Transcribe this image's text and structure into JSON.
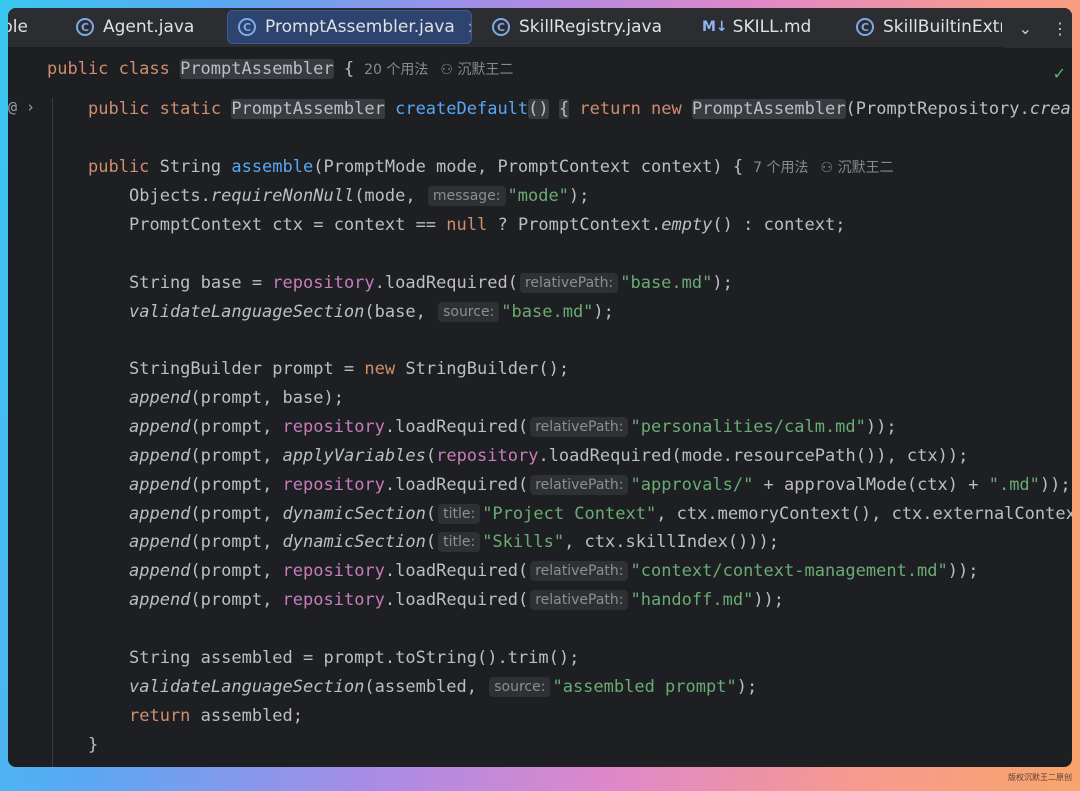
{
  "tabs": [
    {
      "label": "ple",
      "icon": ""
    },
    {
      "label": "Agent.java",
      "icon": "java-class-icon"
    },
    {
      "label": "PromptAssembler.java",
      "icon": "java-class-icon",
      "active": true,
      "close": "×"
    },
    {
      "label": "SkillRegistry.java",
      "icon": "java-class-icon"
    },
    {
      "label": "SKILL.md",
      "icon": "markdown-icon",
      "icon_text": "M↓"
    },
    {
      "label": "SkillBuiltinExtra",
      "icon": "java-class-icon"
    }
  ],
  "tab_tools": {
    "dropdown": "⌄",
    "more": "⋮"
  },
  "class_header": {
    "decl_kw": "public class",
    "name": "PromptAssembler",
    "brace": "{",
    "usages": "20 个用法",
    "author": "沉默王二"
  },
  "gutter_mark": "@ ›",
  "code": {
    "l_create": {
      "kw1": "public static",
      "type": "PromptAssembler",
      "name": "createDefault",
      "paren": "()",
      "brace": "{",
      "ret": "return new",
      "type2": "PromptAssembler",
      "tail": "(PromptRepository.",
      "tail_it": "creat"
    },
    "l_assemble": {
      "kw": "public",
      "sig1": "String",
      "name": "assemble",
      "params": "(PromptMode mode, PromptContext context) {",
      "usages": "7 个用法",
      "author": "沉默王二"
    },
    "l_objects": {
      "a": "Objects.",
      "b": "requireNonNull",
      "c": "(mode,",
      "hint": "message:",
      "str": "\"mode\"",
      "end": ");"
    },
    "l_ctx": {
      "a": "PromptContext ctx = context == ",
      "null": "null",
      "b": " ? PromptContext.",
      "empty": "empty",
      "c": "() : context;"
    },
    "l_base": {
      "a": "String base = ",
      "repo": "repository",
      "b": ".loadRequired(",
      "hint": "relativePath:",
      "str": "\"base.md\"",
      "end": ");"
    },
    "l_validate1": {
      "fn": "validateLanguageSection",
      "a": "(base,",
      "hint": "source:",
      "str": "\"base.md\"",
      "end": ");"
    },
    "l_sb": {
      "a": "StringBuilder prompt = ",
      "kw": "new",
      "b": " StringBuilder();"
    },
    "l_app1": {
      "fn": "append",
      "a": "(prompt, base);"
    },
    "l_app2": {
      "fn": "append",
      "a": "(prompt, ",
      "repo": "repository",
      "b": ".loadRequired(",
      "hint": "relativePath:",
      "str": "\"personalities/calm.md\"",
      "end": "));"
    },
    "l_app3": {
      "fn": "append",
      "a": "(prompt, ",
      "fn2": "applyVariables",
      "b": "(",
      "repo": "repository",
      "c": ".loadRequired(mode.resourcePath()), ctx));"
    },
    "l_app4": {
      "fn": "append",
      "a": "(prompt, ",
      "repo": "repository",
      "b": ".loadRequired(",
      "hint": "relativePath:",
      "str": "\"approvals/\"",
      "c": " + approvalMode(ctx) + ",
      "str2": "\".md\"",
      "end": "));"
    },
    "l_app5": {
      "fn": "append",
      "a": "(prompt, ",
      "fn2": "dynamicSection",
      "b": "(",
      "hint": "title:",
      "str": "\"Project Context\"",
      "c": ", ctx.memoryContext(), ctx.externalContex"
    },
    "l_app6": {
      "fn": "append",
      "a": "(prompt, ",
      "fn2": "dynamicSection",
      "b": "(",
      "hint": "title:",
      "str": "\"Skills\"",
      "c": ", ctx.skillIndex()));"
    },
    "l_app7": {
      "fn": "append",
      "a": "(prompt, ",
      "repo": "repository",
      "b": ".loadRequired(",
      "hint": "relativePath:",
      "str": "\"context/context-management.md\"",
      "end": "));"
    },
    "l_app8": {
      "fn": "append",
      "a": "(prompt, ",
      "repo": "repository",
      "b": ".loadRequired(",
      "hint": "relativePath:",
      "str": "\"handoff.md\"",
      "end": "));"
    },
    "l_assembled": {
      "a": "String assembled = prompt.toString().trim();"
    },
    "l_validate2": {
      "fn": "validateLanguageSection",
      "a": "(assembled,",
      "hint": "source:",
      "str": "\"assembled prompt\"",
      "end": ");"
    },
    "l_return": {
      "kw": "return",
      "a": " assembled;"
    },
    "l_close": {
      "a": "}"
    }
  },
  "status_check": "✓",
  "watermark": "版权沉默王二原创"
}
